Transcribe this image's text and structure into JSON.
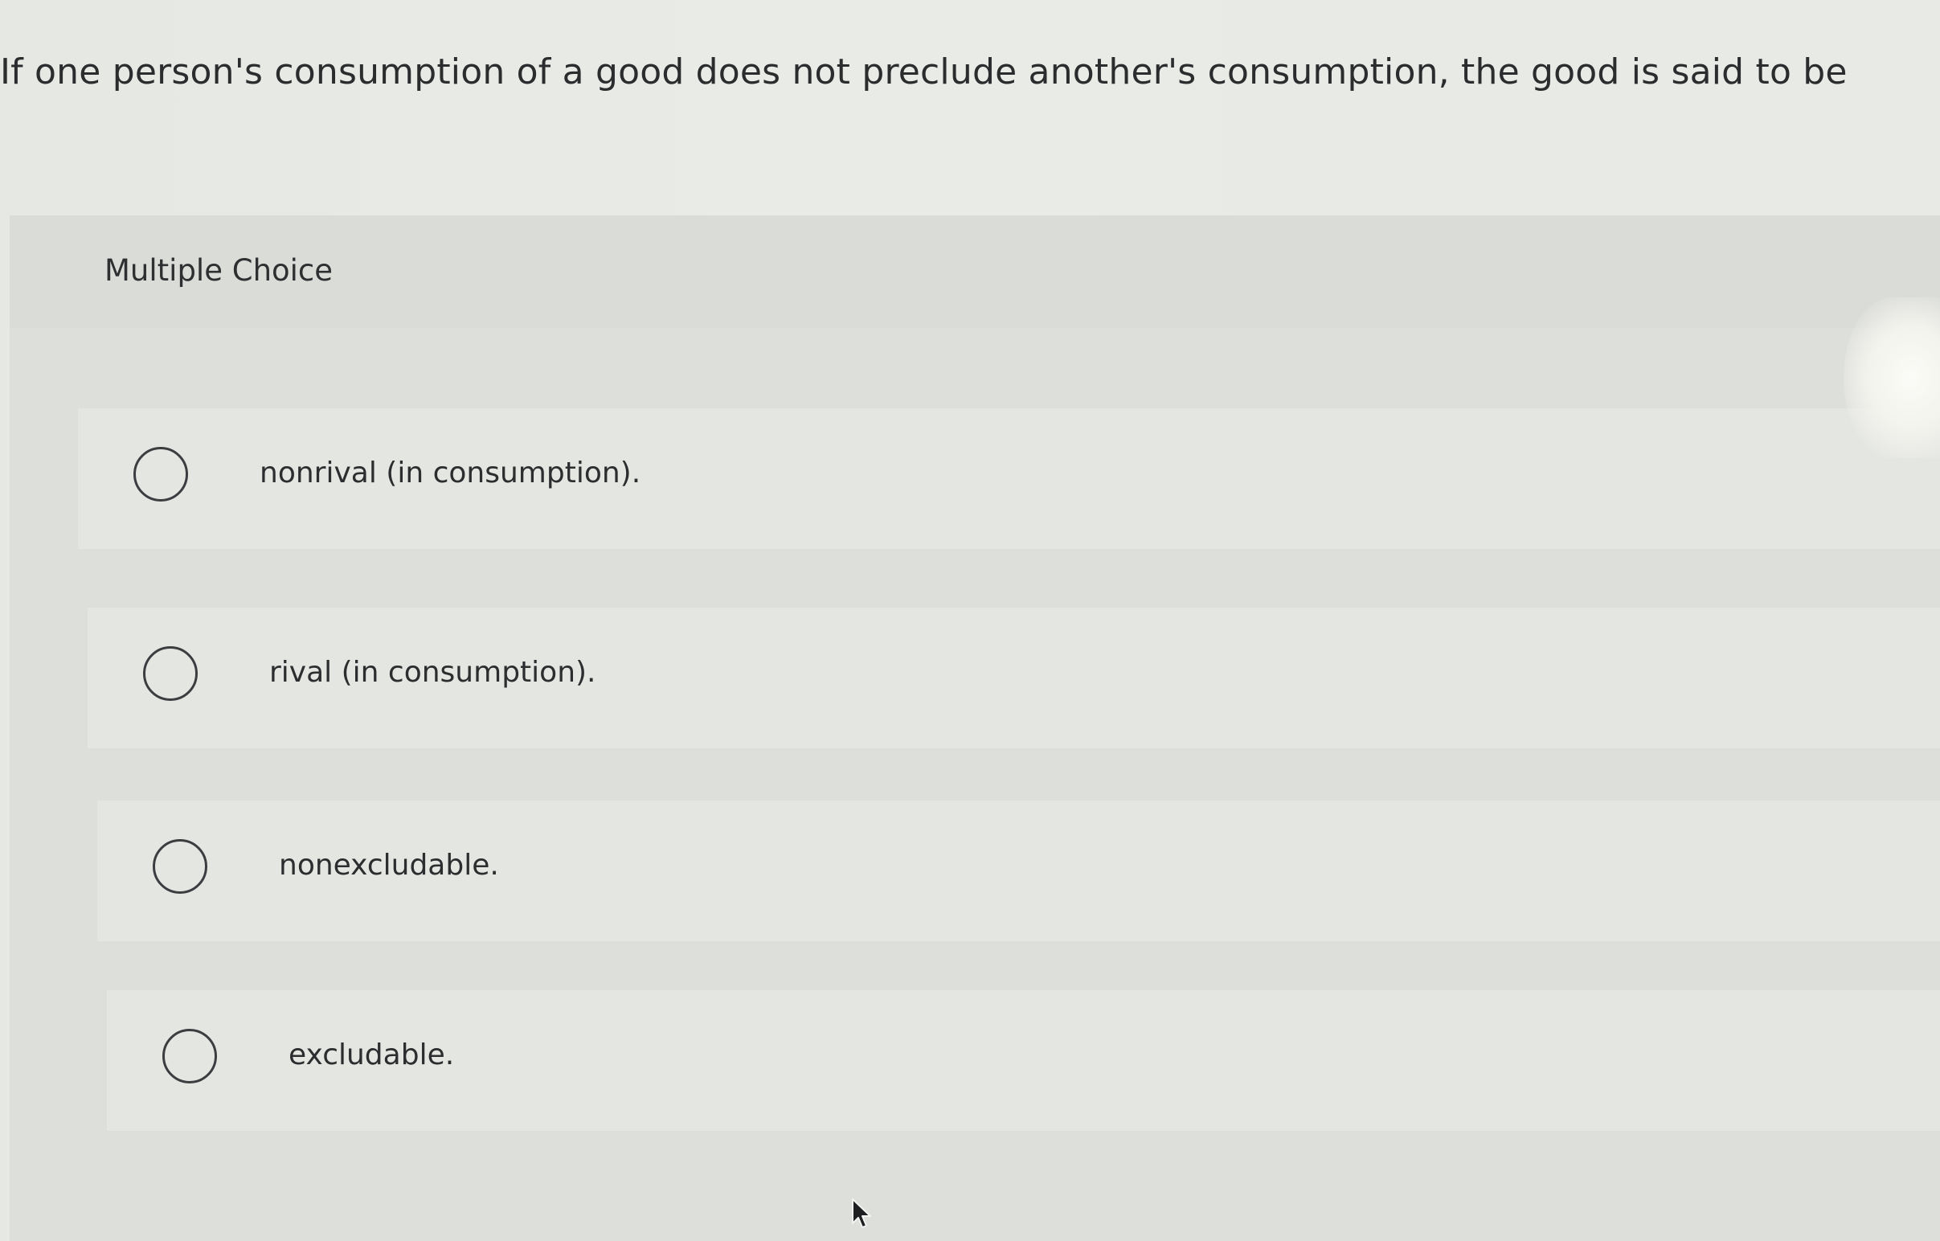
{
  "question": {
    "text": "If one person's consumption of a good does not preclude another's consumption, the good is said to be"
  },
  "multiple_choice": {
    "title": "Multiple Choice",
    "options": [
      {
        "label": "nonrival (in consumption).",
        "selected": false
      },
      {
        "label": "rival (in consumption).",
        "selected": false
      },
      {
        "label": "nonexcludable.",
        "selected": false
      },
      {
        "label": "excludable.",
        "selected": false
      }
    ]
  },
  "icons": {
    "radio": "radio-circle-icon",
    "cursor": "mouse-pointer-icon"
  },
  "colors": {
    "background": "#e7e9e5",
    "panel": "#dddfdb",
    "option_bg": "#e4e6e2",
    "text": "#2b2d2f",
    "radio_border": "#3b3d40"
  }
}
